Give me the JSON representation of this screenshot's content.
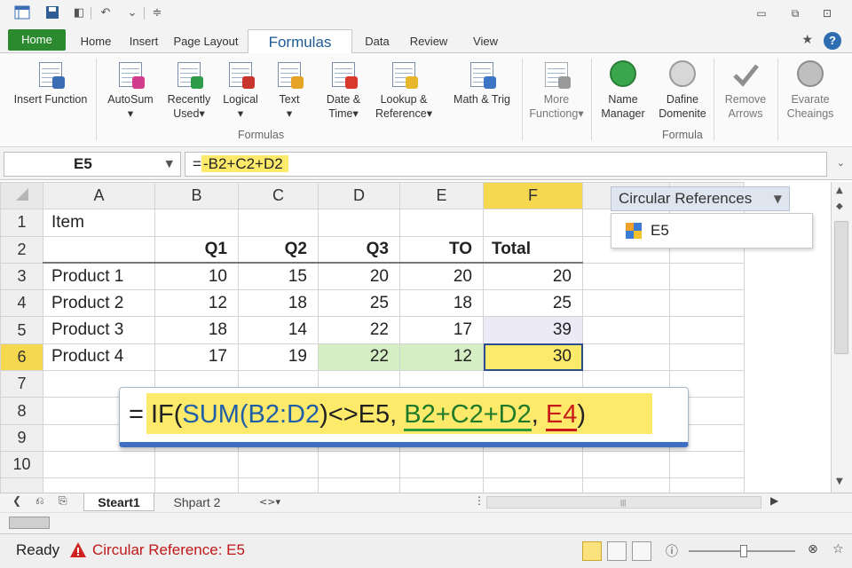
{
  "tabs": {
    "file": "Home",
    "items": [
      "Home",
      "Insert",
      "Page Layout",
      "Formulas",
      "Data",
      "Review",
      "View"
    ]
  },
  "ribbon": {
    "insert_function": "Insert Function",
    "autosum": "AutoSum",
    "recently_used": [
      "Recently",
      "Used"
    ],
    "logical": "Logical",
    "text": "Text",
    "date_time": [
      "Date &",
      "Time"
    ],
    "lookup_reference": [
      "Lookup &",
      "Reference"
    ],
    "math_trig": "Math & Trig",
    "more_functions": [
      "More",
      "Functiong"
    ],
    "group_formulas": "Formulas",
    "name_manager": [
      "Name",
      "Manager"
    ],
    "define_name": [
      "Dafine",
      "Domenite"
    ],
    "remove_arrows": [
      "Remove",
      "Arrows"
    ],
    "evaluate_checks": [
      "Evarate",
      "Cheaings"
    ],
    "group_formula": "Formula"
  },
  "formula_bar": {
    "name_box": "E5",
    "equals": "=",
    "formula": "-B2+C2+D2"
  },
  "grid": {
    "columns": [
      "A",
      "B",
      "C",
      "D",
      "E",
      "F"
    ],
    "rows": [
      {
        "n": "1",
        "cells": [
          "Item",
          "",
          "",
          "",
          "",
          ""
        ]
      },
      {
        "n": "2",
        "cells": [
          "",
          "Q1",
          "Q2",
          "Q3",
          "TO",
          "Total"
        ]
      },
      {
        "n": "3",
        "cells": [
          "Product 1",
          "10",
          "15",
          "20",
          "20",
          "20"
        ]
      },
      {
        "n": "4",
        "cells": [
          "Product 2",
          "12",
          "18",
          "25",
          "18",
          "25"
        ]
      },
      {
        "n": "5",
        "cells": [
          "Product 3",
          "18",
          "14",
          "22",
          "17",
          "39"
        ]
      },
      {
        "n": "6",
        "cells": [
          "Product 4",
          "17",
          "19",
          "22",
          "12",
          "30"
        ]
      },
      {
        "n": "7",
        "cells": [
          "",
          "",
          "",
          "",
          "",
          ""
        ]
      },
      {
        "n": "8",
        "cells": [
          "",
          "",
          "",
          "",
          "",
          ""
        ]
      },
      {
        "n": "9",
        "cells": [
          "",
          "",
          "",
          "",
          "",
          ""
        ]
      },
      {
        "n": "10",
        "cells": [
          "",
          "",
          "",
          "",
          "",
          ""
        ]
      }
    ]
  },
  "circular_refs": {
    "title": "Circular References",
    "item": "E5"
  },
  "callout": {
    "p1": "= IF(",
    "p2": "SUM(",
    "p3": "B2:D2",
    "p4": ")<>E5, ",
    "p5": "B2+C2+D2",
    "p6": ", ",
    "p7": "E4",
    "p8": ")"
  },
  "sheets": {
    "active": "Steart1",
    "other": "Shpart 2",
    "more": "<>"
  },
  "status": {
    "ready": "Ready",
    "circular": "Circular Reference: E5"
  },
  "colors": {
    "file_tab": "#2b8a2f",
    "active_cell": "#fde96a",
    "warning": "#c01818",
    "green_cells": "#d6eec3"
  }
}
